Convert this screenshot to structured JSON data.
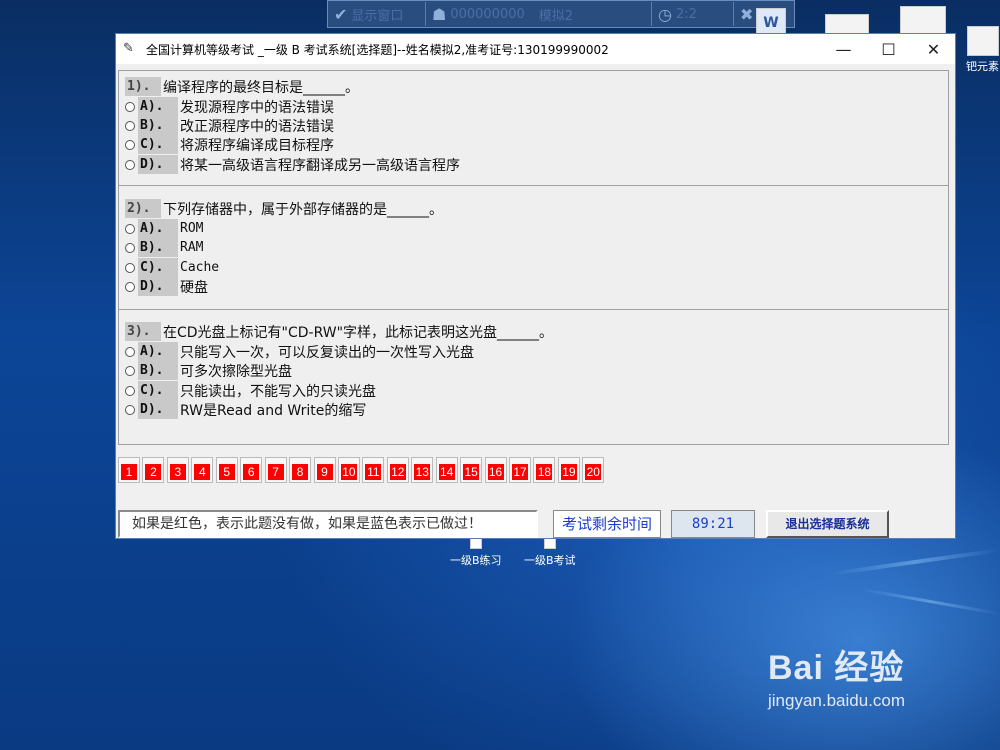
{
  "topbar": {
    "show_window": "显示窗口",
    "id_text": "000000000",
    "mode": "模拟2",
    "time": "2:2"
  },
  "desktop": {
    "right_icon_label": "钯元素",
    "shortcuts": [
      {
        "label": "一级B练习"
      },
      {
        "label": "一级B考试"
      }
    ]
  },
  "window": {
    "title": "全国计算机等级考试 _一级 B 考试系统[选择题]--姓名模拟2,准考证号:130199990002",
    "minimize": "—",
    "maximize": "☐",
    "close": "✕"
  },
  "questions": [
    {
      "num": "1).",
      "text": "编译程序的最终目标是______。",
      "options": [
        {
          "label": "A).",
          "text": "发现源程序中的语法错误"
        },
        {
          "label": "B).",
          "text": "改正源程序中的语法错误"
        },
        {
          "label": "C).",
          "text": "将源程序编译成目标程序"
        },
        {
          "label": "D).",
          "text": "将某一高级语言程序翻译成另一高级语言程序"
        }
      ]
    },
    {
      "num": "2).",
      "text": "下列存储器中，属于外部存储器的是______。",
      "options": [
        {
          "label": "A).",
          "text": "ROM"
        },
        {
          "label": "B).",
          "text": "RAM"
        },
        {
          "label": "C).",
          "text": "Cache"
        },
        {
          "label": "D).",
          "text": "硬盘"
        }
      ]
    },
    {
      "num": "3).",
      "text": "在CD光盘上标记有\"CD-RW\"字样，此标记表明这光盘______。",
      "options": [
        {
          "label": "A).",
          "text": "只能写入一次，可以反复读出的一次性写入光盘"
        },
        {
          "label": "B).",
          "text": "可多次擦除型光盘"
        },
        {
          "label": "C).",
          "text": "只能读出，不能写入的只读光盘"
        },
        {
          "label": "D).",
          "text": "RW是Read and Write的缩写"
        }
      ]
    }
  ],
  "question_numbers": [
    "1",
    "2",
    "3",
    "4",
    "5",
    "6",
    "7",
    "8",
    "9",
    "10",
    "11",
    "12",
    "13",
    "14",
    "15",
    "16",
    "17",
    "18",
    "19",
    "20"
  ],
  "status": {
    "hint": "如果是红色，表示此题没有做，如果是蓝色表示已做过！",
    "time_label": "考试剩余时间",
    "time_value": "89:21",
    "exit_button": "退出选择题系统"
  },
  "watermark": {
    "logo": "Bai 经验",
    "url": "jingyan.baidu.com"
  },
  "colors": {
    "unanswered": "#ff0000",
    "timer_text": "#1a3fd0"
  }
}
